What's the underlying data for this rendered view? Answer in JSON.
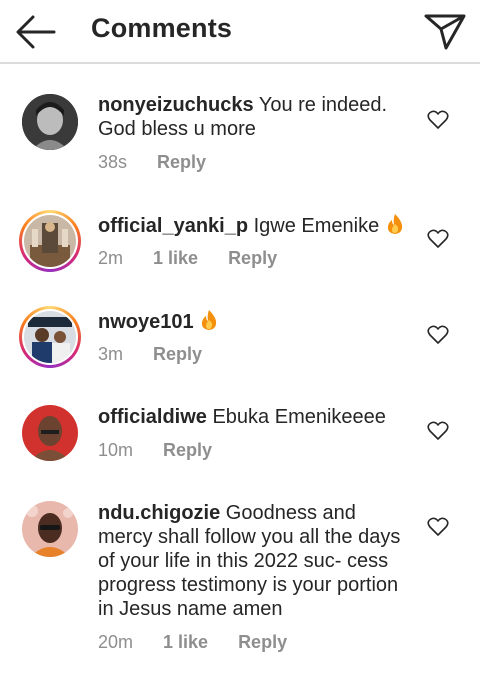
{
  "header": {
    "title": "Comments",
    "back_icon": "arrow-left-icon",
    "send_icon": "paper-plane-icon"
  },
  "comments": [
    {
      "username": "nonyeizuchucks",
      "text": "You re indeed. God bless u more",
      "time": "38s",
      "likes": "",
      "reply": "Reply",
      "emoji": ""
    },
    {
      "username": "official_yanki_p",
      "text": "Igwe Emenike",
      "time": "2m",
      "likes": "1 like",
      "reply": "Reply",
      "emoji": "fire-emoji"
    },
    {
      "username": "nwoye101",
      "text": "",
      "time": "3m",
      "likes": "",
      "reply": "Reply",
      "emoji": "fire-emoji"
    },
    {
      "username": "officialdiwe",
      "text": "Ebuka Emenikeeee",
      "time": "10m",
      "likes": "",
      "reply": "Reply",
      "emoji": ""
    },
    {
      "username": "ndu.chigozie",
      "text": "Goodness and mercy shall follow you all the days of your life in this 2022 suc- cess progress testimony is your portion in Jesus name amen",
      "time": "20m",
      "likes": "1 like",
      "reply": "Reply",
      "emoji": ""
    }
  ],
  "colors": {
    "text": "#262626",
    "meta": "#8e8e8e",
    "divider": "#dbdbdb",
    "story_ring": "#d62976"
  }
}
